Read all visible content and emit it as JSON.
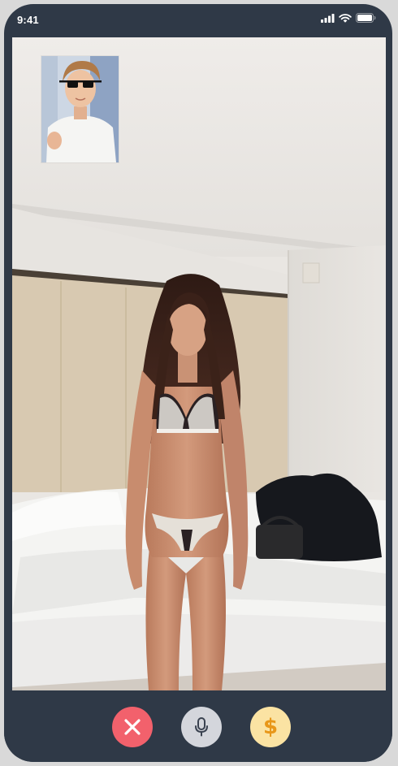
{
  "status_bar": {
    "time": "9:41",
    "icons": [
      "cellular-signal-icon",
      "wifi-icon",
      "battery-icon"
    ]
  },
  "call": {
    "remote_video": "remote-participant-video",
    "self_view": "self-view-thumbnail"
  },
  "controls": {
    "buttons": [
      {
        "name": "end-call-button",
        "icon": "close-icon",
        "color": "#f2616c"
      },
      {
        "name": "mic-button",
        "icon": "microphone-icon",
        "color": "#d4d6dc"
      },
      {
        "name": "tip-button",
        "icon": "dollar-icon",
        "symbol": "$",
        "color": "#fbe3a3"
      }
    ]
  },
  "colors": {
    "frame": "#2f3947",
    "end_call": "#f2616c",
    "mic": "#d4d6dc",
    "tip": "#fbe3a3",
    "tip_symbol": "#e89719"
  }
}
